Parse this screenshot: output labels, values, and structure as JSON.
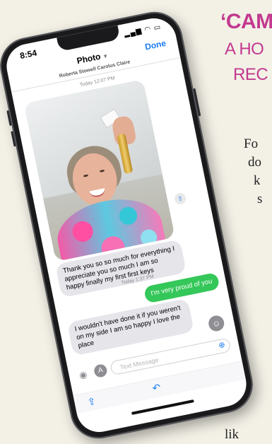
{
  "article": {
    "headline": "‘CAM",
    "subhead_line1": "A HO",
    "subhead_line2": "REC",
    "body_lines": [
      "Fo",
      "do",
      "k",
      "s"
    ],
    "footer_fragment": "lik"
  },
  "phone": {
    "status": {
      "time": "8:54"
    },
    "navbar": {
      "title": "Photo",
      "done_label": "Done",
      "contact_name": "Roberta Stowell Carolus Claire"
    },
    "timestamps": [
      "Today 12:07 PM",
      "Today 1:37 PM"
    ],
    "messages": [
      {
        "direction": "incoming",
        "text": "Thank you so so much for everything I appreciate you so much I am so happy finally my first first keys"
      },
      {
        "direction": "outgoing",
        "text": "I'm very proud of you"
      },
      {
        "direction": "incoming",
        "text": "I wouldn't have done it if you weren't on my side I am so happy I love the place"
      }
    ],
    "composer": {
      "placeholder": "Text Message"
    },
    "icons": [
      "signal-icon",
      "wifi-icon",
      "battery-icon",
      "chevron-down-icon",
      "share-icon",
      "camera-icon",
      "app-store-icon",
      "zoom-icon",
      "reaction-icon",
      "reply-icon"
    ]
  }
}
